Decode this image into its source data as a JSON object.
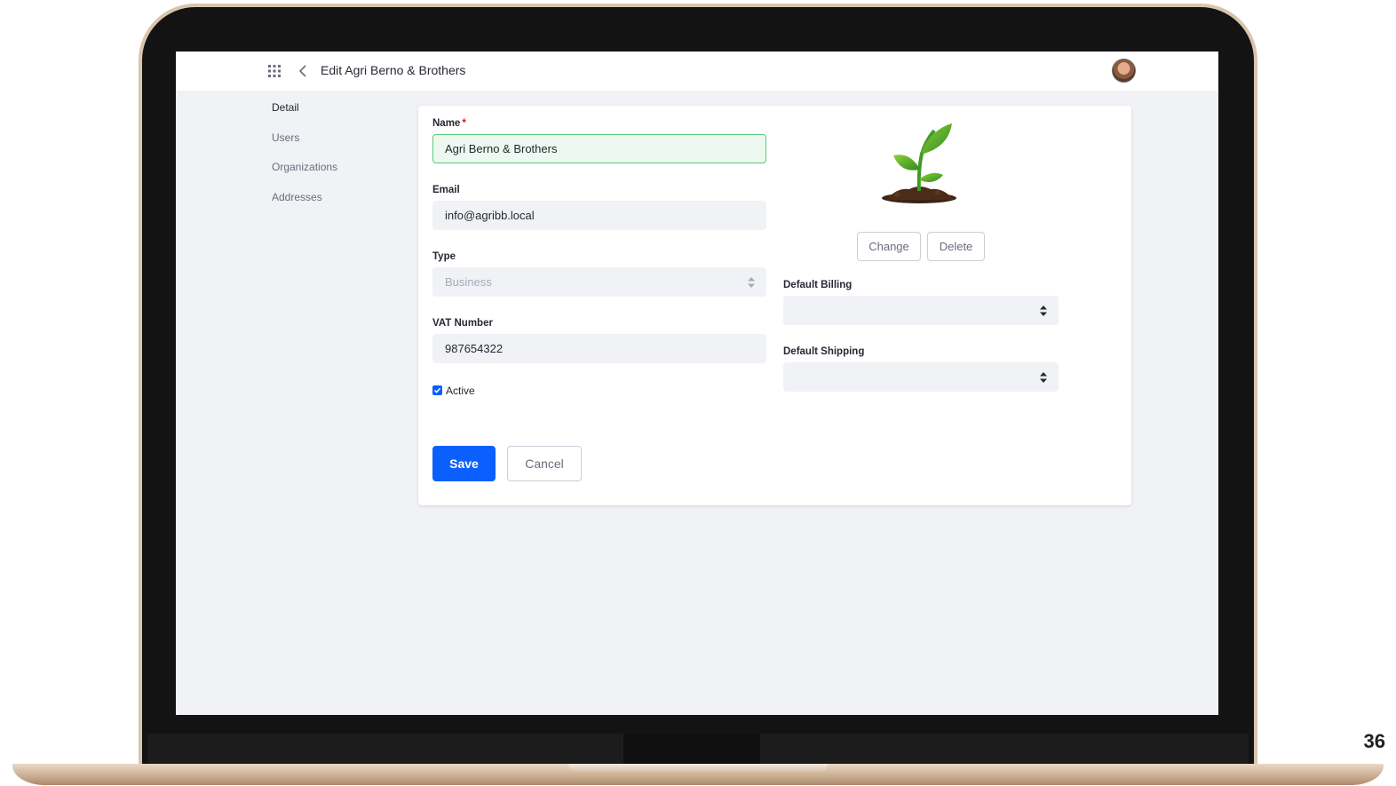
{
  "header": {
    "title": "Edit Agri Berno & Brothers",
    "apps_icon": "apps-grid-icon",
    "back_icon": "chevron-left-icon"
  },
  "sidebar": {
    "items": [
      {
        "label": "Detail",
        "active": true
      },
      {
        "label": "Users",
        "active": false
      },
      {
        "label": "Organizations",
        "active": false
      },
      {
        "label": "Addresses",
        "active": false
      }
    ]
  },
  "form": {
    "name": {
      "label": "Name",
      "required_marker": "*",
      "value": "Agri Berno & Brothers"
    },
    "email": {
      "label": "Email",
      "value": "info@agribb.local"
    },
    "type": {
      "label": "Type",
      "value": "Business"
    },
    "vat": {
      "label": "VAT Number",
      "value": "987654322"
    },
    "active": {
      "label": "Active",
      "checked": true
    },
    "default_billing": {
      "label": "Default Billing",
      "value": ""
    },
    "default_shipping": {
      "label": "Default Shipping",
      "value": ""
    },
    "logo": {
      "icon": "plant-sprout-icon",
      "change_label": "Change",
      "delete_label": "Delete"
    },
    "save_label": "Save",
    "cancel_label": "Cancel"
  },
  "slide": {
    "page_number": "36"
  },
  "colors": {
    "primary": "#0b5fff",
    "focus_border": "#5aca75",
    "focus_bg": "#edf9f0",
    "required": "#da1414",
    "background": "#f1f2f5"
  }
}
